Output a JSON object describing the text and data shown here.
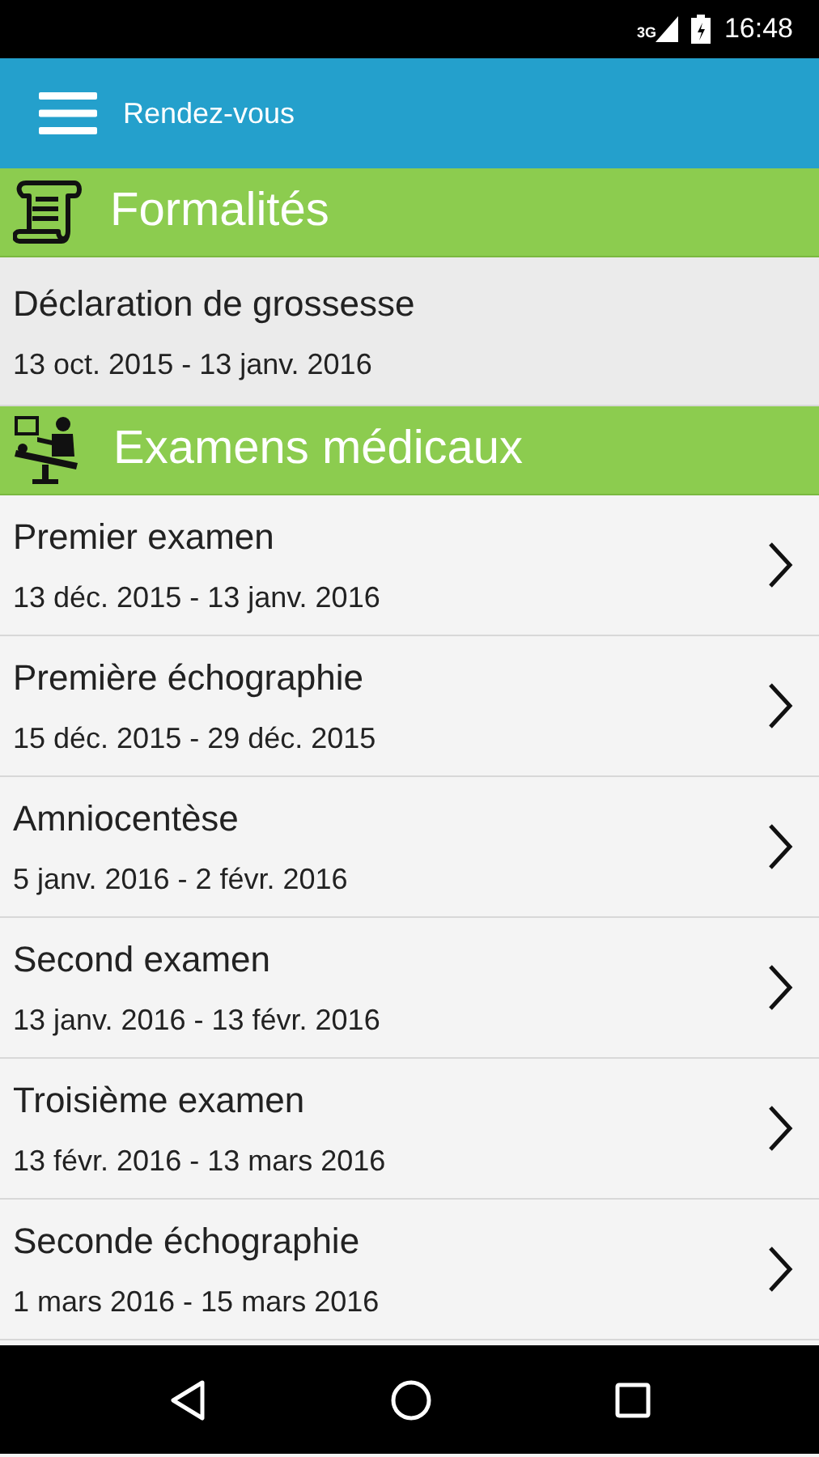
{
  "status_bar": {
    "network": "3G",
    "time": "16:48"
  },
  "app_bar": {
    "title": "Rendez-vous"
  },
  "sections": [
    {
      "title": "Formalités",
      "kind": "scroll",
      "items": [
        {
          "title": "Déclaration de grossesse",
          "dates": "13 oct. 2015 - 13 janv. 2016",
          "kind": "plain"
        }
      ]
    },
    {
      "title": "Examens médicaux",
      "kind": "doctor",
      "items": [
        {
          "title": "Premier examen",
          "dates": "13 déc. 2015 - 13 janv. 2016",
          "kind": "link"
        },
        {
          "title": "Première échographie",
          "dates": "15 déc. 2015 - 29 déc. 2015",
          "kind": "link"
        },
        {
          "title": "Amniocentèse",
          "dates": "5 janv. 2016 - 2 févr. 2016",
          "kind": "link"
        },
        {
          "title": "Second examen",
          "dates": "13 janv. 2016 - 13 févr. 2016",
          "kind": "link"
        },
        {
          "title": "Troisième examen",
          "dates": "13 févr. 2016 - 13 mars 2016",
          "kind": "link"
        },
        {
          "title": "Seconde échographie",
          "dates": "1 mars 2016 - 15 mars 2016",
          "kind": "link"
        }
      ]
    }
  ]
}
